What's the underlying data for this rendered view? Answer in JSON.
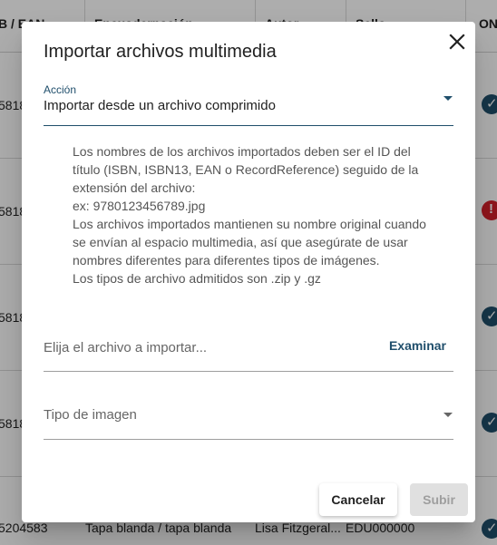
{
  "background": {
    "headers": [
      "B / EAN",
      "Encuadernación",
      "Autor",
      "Sello",
      "ONIX"
    ],
    "rows": [
      {
        "isbn": "5818",
        "status": "ok"
      },
      {
        "isbn": "5818",
        "status": "error"
      },
      {
        "isbn": "5818",
        "status": "ok"
      },
      {
        "isbn": "5818",
        "status": "ok"
      }
    ],
    "last_row": {
      "isbn": "5204583",
      "format": "Tapa blanda / tapa blanda",
      "author": "Lisa Fitzgeral...",
      "imprint": "EDU000000"
    }
  },
  "dialog": {
    "title": "Importar archivos multimedia",
    "accion": {
      "label": "Acción",
      "value": "Importar desde un archivo comprimido"
    },
    "info_lines": [
      "Los nombres de los archivos importados deben ser el ID del",
      "título (ISBN, ISBN13, EAN o RecordReference) seguido de la",
      "extensión del archivo:",
      "ex: 9780123456789.jpg",
      "Los archivos importados mantienen su nombre original cuando",
      "se envían al espacio multimedia, así que asegúrate de usar",
      "nombres diferentes para diferentes tipos de imágenes.",
      "Los tipos de archivo admitidos son .zip y .gz"
    ],
    "file_placeholder": "Elija el archivo a importar...",
    "browse_label": "Examinar",
    "image_type_placeholder": "Tipo de imagen",
    "cancel_label": "Cancelar",
    "submit_label": "Subir"
  },
  "colors": {
    "accent": "#1f4e6b",
    "status_ok": "#1f4e6b",
    "status_error": "#d3202a",
    "disabled_bg": "#e0e0e0"
  }
}
